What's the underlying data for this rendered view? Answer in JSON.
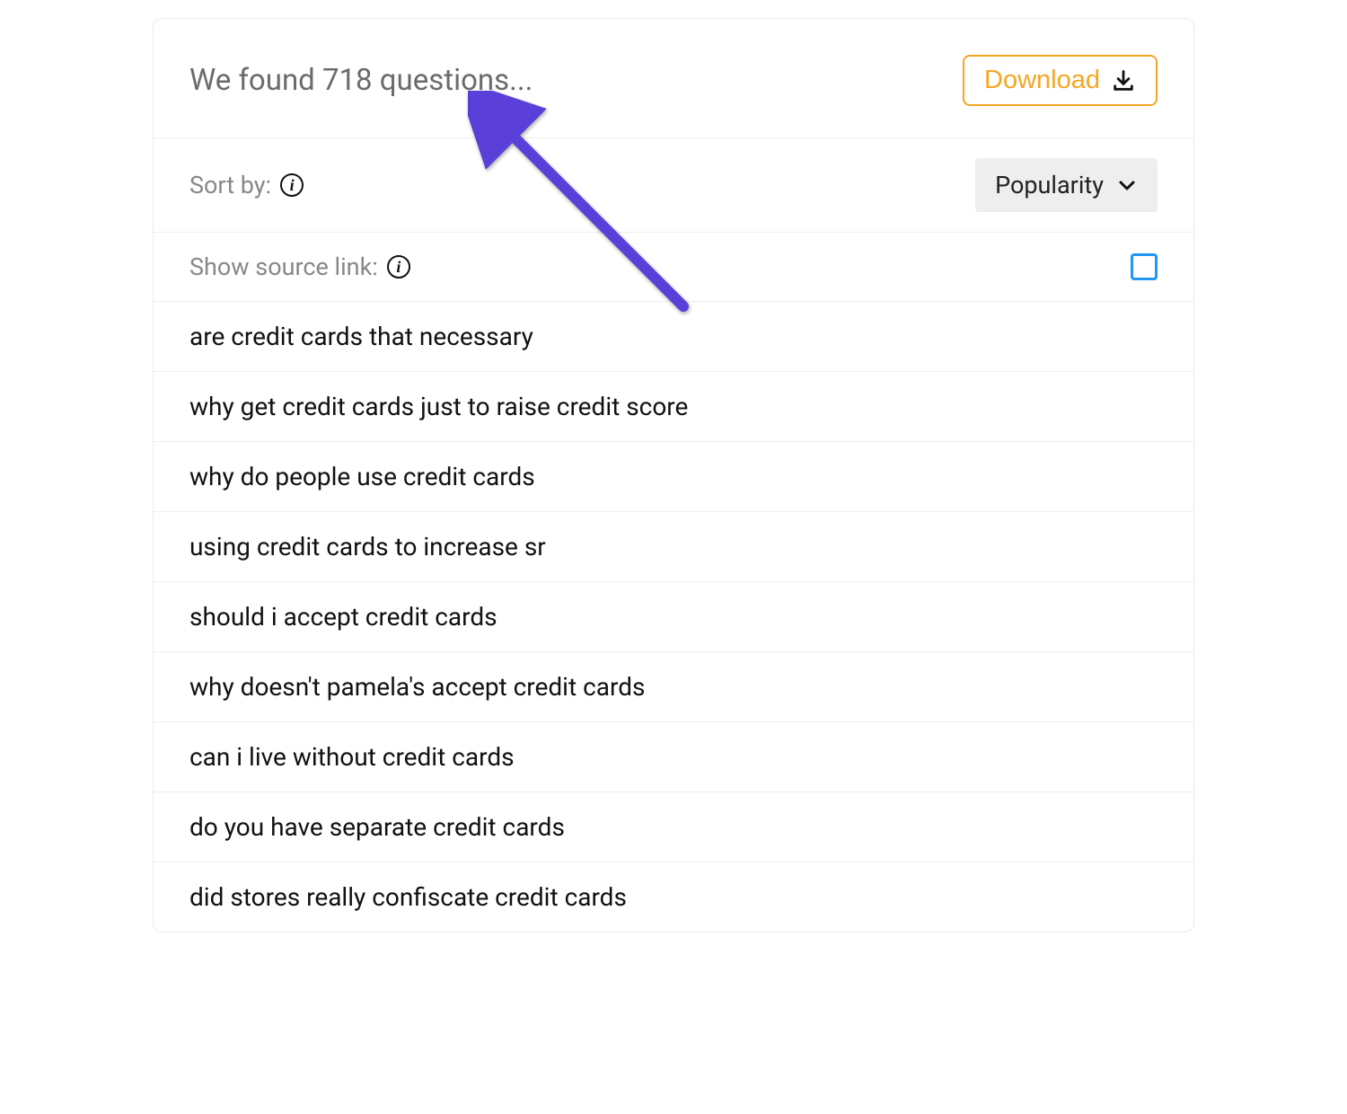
{
  "header": {
    "results_title": "We found 718 questions...",
    "download_label": "Download"
  },
  "sort": {
    "label": "Sort by:",
    "selected": "Popularity"
  },
  "source": {
    "label": "Show source link:",
    "checked": false
  },
  "questions": [
    "are credit cards that necessary",
    "why get credit cards just to raise credit score",
    "why do people use credit cards",
    "using credit cards to increase sr",
    "should i accept credit cards",
    "why doesn't pamela's accept credit cards",
    "can i live without credit cards",
    "do you have separate credit cards",
    "did stores really confiscate credit cards"
  ],
  "colors": {
    "accent": "#f5a623",
    "muted": "#888888",
    "checkbox": "#2196f3",
    "arrow": "#5b3fd9"
  }
}
